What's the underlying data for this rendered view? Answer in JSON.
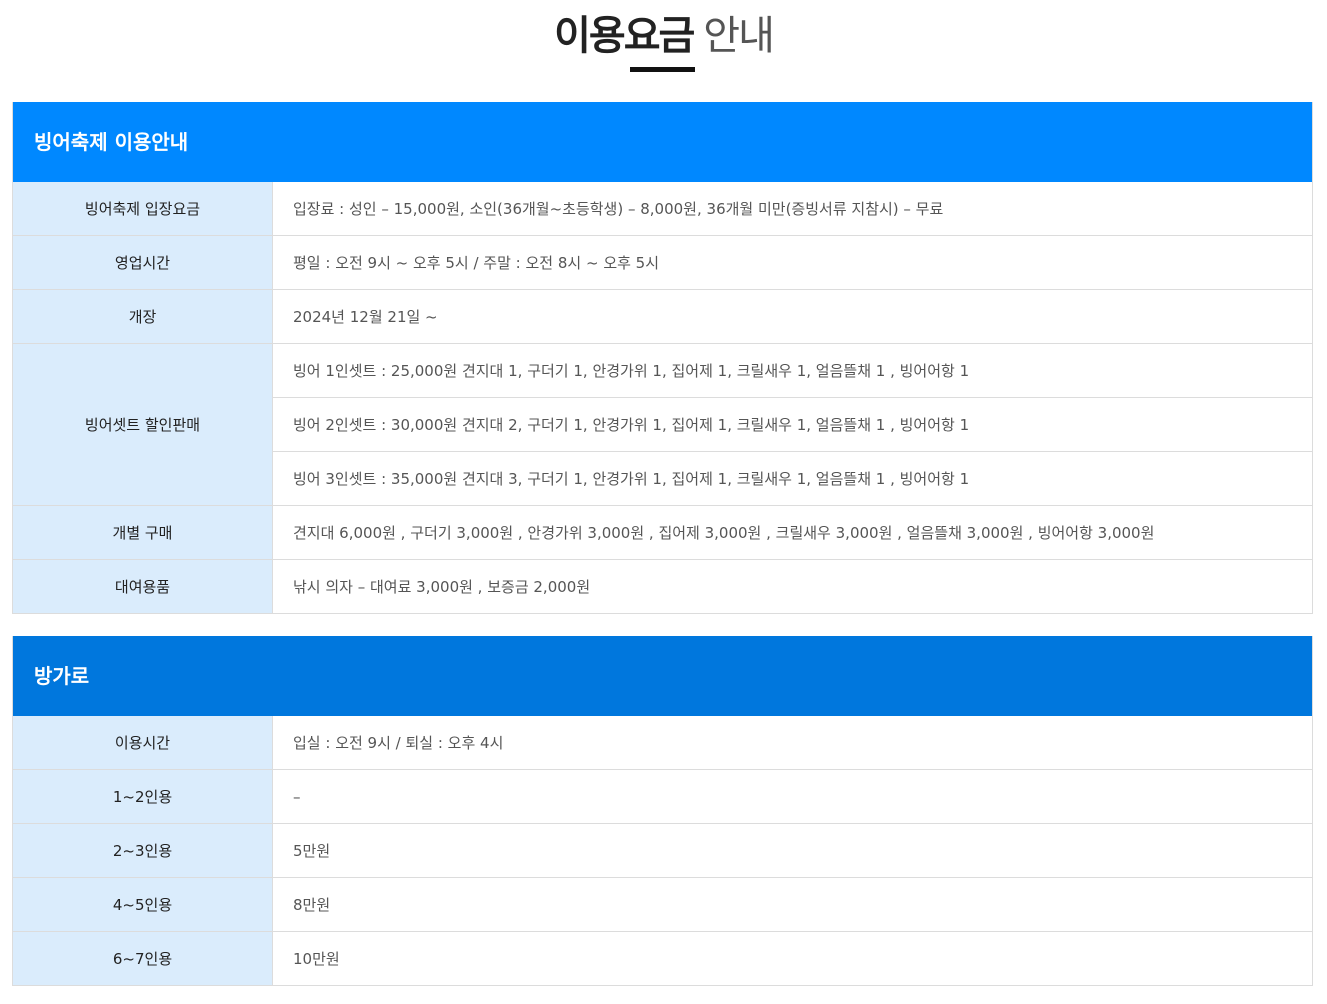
{
  "header": {
    "title_strong": "이용요금",
    "title_light": "안내"
  },
  "colors": {
    "panel1_header_bg": "#0088ff",
    "panel2_header_bg": "#0077dd",
    "row_header_bg": "#daecfc"
  },
  "panels": [
    {
      "title": "빙어축제 이용안내",
      "rows": [
        {
          "label": "빙어축제 입장요금",
          "values": [
            "입장료 : 성인 – 15,000원, 소인(36개월~초등학생) – 8,000원, 36개월 미만(증빙서류 지참시) – 무료"
          ]
        },
        {
          "label": "영업시간",
          "values": [
            "평일 : 오전 9시 ~ 오후 5시 / 주말 : 오전 8시 ~ 오후 5시"
          ]
        },
        {
          "label": "개장",
          "values": [
            "2024년 12월 21일 ~"
          ]
        },
        {
          "label": "빙어셋트 할인판매",
          "values": [
            "빙어 1인셋트 : 25,000원 견지대 1, 구더기 1, 안경가위 1, 집어제 1, 크릴새우 1, 얼음뜰채 1 , 빙어어항 1",
            "빙어 2인셋트 : 30,000원 견지대 2, 구더기 1, 안경가위 1, 집어제 1, 크릴새우 1, 얼음뜰채 1 , 빙어어항 1",
            "빙어 3인셋트 : 35,000원 견지대 3, 구더기 1, 안경가위 1, 집어제 1, 크릴새우 1, 얼음뜰채 1 , 빙어어항 1"
          ]
        },
        {
          "label": "개별 구매",
          "values": [
            "견지대 6,000원 , 구더기 3,000원 , 안경가위 3,000원 , 집어제 3,000원 , 크릴새우 3,000원 , 얼음뜰채 3,000원 , 빙어어항 3,000원"
          ]
        },
        {
          "label": "대여용품",
          "values": [
            "낚시 의자 – 대여료 3,000원 , 보증금 2,000원"
          ]
        }
      ]
    },
    {
      "title": "방가로",
      "rows": [
        {
          "label": "이용시간",
          "values": [
            "입실 : 오전 9시 / 퇴실 : 오후 4시"
          ]
        },
        {
          "label": "1~2인용",
          "values": [
            "–"
          ]
        },
        {
          "label": "2~3인용",
          "values": [
            "5만원"
          ]
        },
        {
          "label": "4~5인용",
          "values": [
            "8만원"
          ]
        },
        {
          "label": "6~7인용",
          "values": [
            "10만원"
          ]
        }
      ]
    }
  ]
}
